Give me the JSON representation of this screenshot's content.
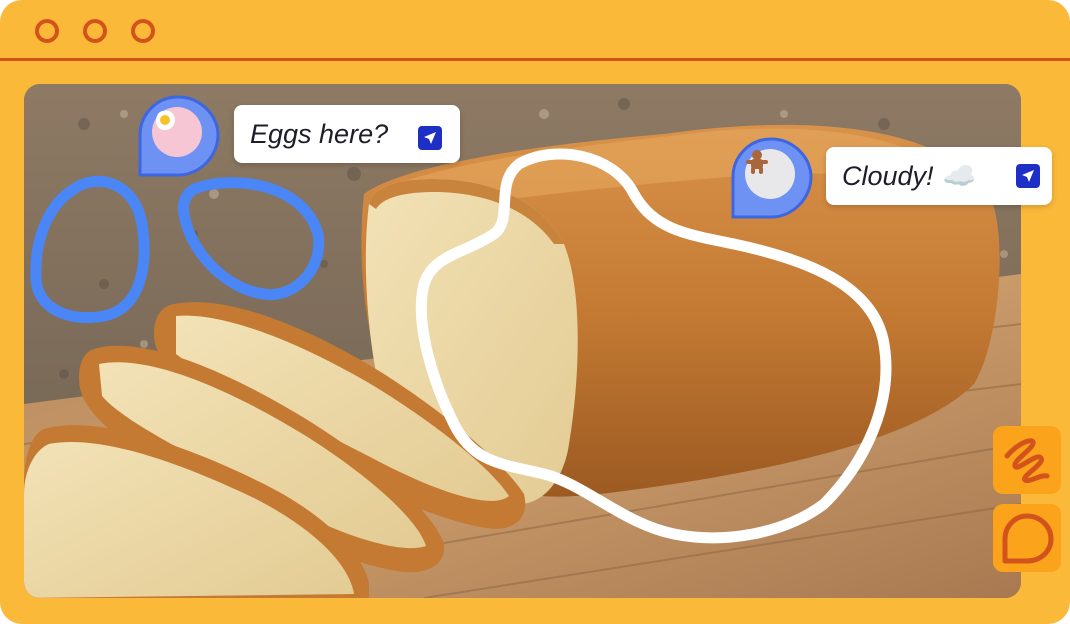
{
  "window": {
    "controls": [
      "close",
      "minimize",
      "maximize"
    ],
    "colors": {
      "frame": "#fbb93a",
      "accent": "#d2531b",
      "tool_bg": "#fba41b"
    }
  },
  "canvas": {
    "image_subject": "loaf-of-bread-on-cutting-board",
    "annotations": [
      {
        "color": "#4a86f5",
        "shape": "freehand-loop"
      },
      {
        "color": "#4a86f5",
        "shape": "freehand-loop"
      },
      {
        "color": "#ffffff",
        "shape": "freehand-loop"
      }
    ]
  },
  "comments": [
    {
      "avatar_icon": "fried-egg-icon",
      "avatar_bg": "#f6c6d4",
      "text": "Eggs here?",
      "send_icon": "send-icon"
    },
    {
      "avatar_icon": "gingerbread-icon",
      "avatar_bg": "#e8e8ea",
      "text": "Cloudy! ☁️",
      "send_icon": "send-icon"
    }
  ],
  "tools": [
    {
      "name": "draw-tool",
      "icon": "squiggle-icon"
    },
    {
      "name": "comment-tool",
      "icon": "speech-bubble-icon"
    }
  ]
}
